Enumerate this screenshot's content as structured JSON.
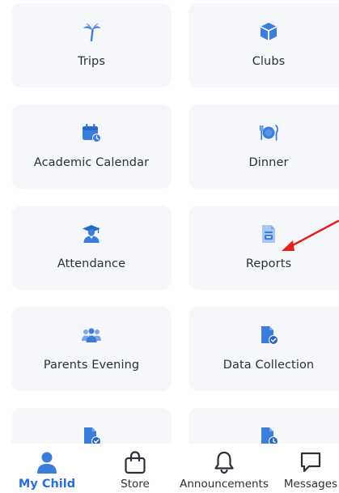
{
  "accent_color": "#3b7ddd",
  "annotation_color": "#e0231b",
  "tiles": [
    {
      "label": "Trips",
      "icon": "palm-tree-icon"
    },
    {
      "label": "Clubs",
      "icon": "cube-icon"
    },
    {
      "label": "Academic Calendar",
      "icon": "calendar-clock-icon"
    },
    {
      "label": "Dinner",
      "icon": "plate-cutlery-icon"
    },
    {
      "label": "Attendance",
      "icon": "graduate-icon"
    },
    {
      "label": "Reports",
      "icon": "report-document-icon"
    },
    {
      "label": "Parents Evening",
      "icon": "people-group-icon"
    },
    {
      "label": "Data Collection",
      "icon": "document-check-icon"
    },
    {
      "label": "",
      "icon": "document-check-icon"
    },
    {
      "label": "",
      "icon": "document-clock-icon"
    }
  ],
  "bottom_nav": [
    {
      "label": "My Child",
      "icon": "person-icon",
      "active": true
    },
    {
      "label": "Store",
      "icon": "shopping-bag-icon",
      "active": false
    },
    {
      "label": "Announcements",
      "icon": "bell-icon",
      "active": false
    },
    {
      "label": "Messages",
      "icon": "message-icon",
      "active": false
    }
  ]
}
